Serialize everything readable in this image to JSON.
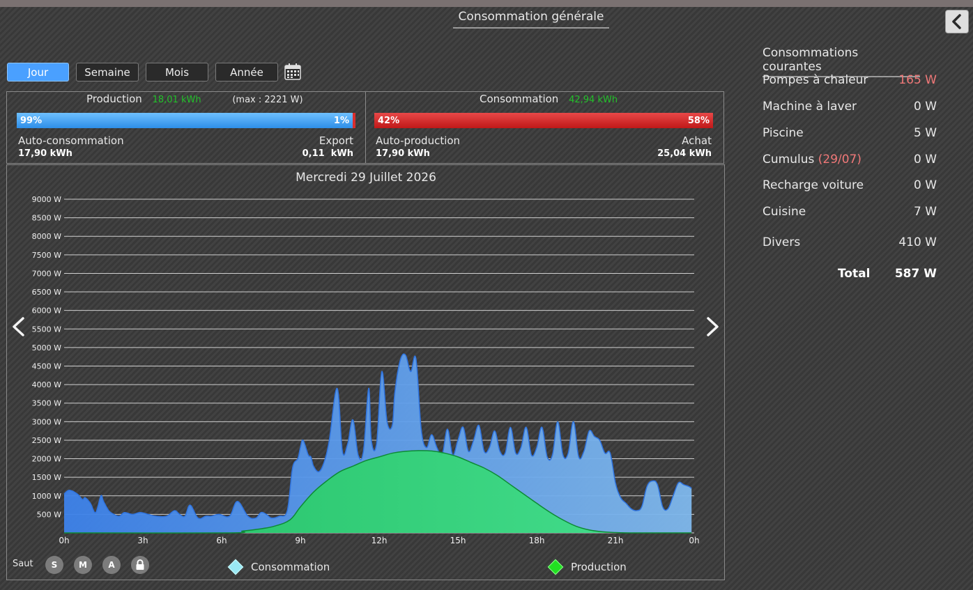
{
  "header": {
    "title": "Consommation générale"
  },
  "period_tabs": [
    {
      "label": "Jour",
      "active": true
    },
    {
      "label": "Semaine",
      "active": false
    },
    {
      "label": "Mois",
      "active": false
    },
    {
      "label": "Année",
      "active": false
    }
  ],
  "production": {
    "label": "Production",
    "total": "18,01 kWh",
    "max": "(max : 2221 W)",
    "bar_left": "99%",
    "bar_right": "1%",
    "self_label": "Auto-consommation",
    "self_value": "17,90 kWh",
    "export_label": "Export",
    "export_value": "0,11  kWh"
  },
  "consumption": {
    "label": "Consommation",
    "total": "42,94 kWh",
    "bar_left": "42%",
    "bar_right": "58%",
    "self_label": "Auto-production",
    "self_value": "17,90 kWh",
    "buy_label": "Achat",
    "buy_value": "25,04 kWh"
  },
  "colors": {
    "accent": "#4aa0ff",
    "production_value": "#22c02a",
    "consumption_fill": "#4a90e8",
    "production_fill": "#2ed36e",
    "alert": "#f07878"
  },
  "jump": {
    "label": "Saut",
    "buttons": [
      "S",
      "M",
      "A"
    ],
    "lock_icon": "lock-icon"
  },
  "chart_data": {
    "type": "area",
    "title": "Mercredi 29 Juillet 2026",
    "x_ticks": [
      "0h",
      "3h",
      "6h",
      "9h",
      "12h",
      "15h",
      "18h",
      "21h",
      "0h"
    ],
    "y_ticks": [
      "500 W",
      "1000 W",
      "1500 W",
      "2000 W",
      "2500 W",
      "3000 W",
      "3500 W",
      "4000 W",
      "4500 W",
      "5000 W",
      "5500 W",
      "6000 W",
      "6500 W",
      "7000 W",
      "7500 W",
      "8000 W",
      "8500 W",
      "9000 W"
    ],
    "ylim": [
      0,
      9000
    ],
    "xlim": [
      0,
      24
    ],
    "grid": true,
    "legend": "bottom",
    "series": [
      {
        "name": "Consommation",
        "x": [
          0,
          0.2,
          0.5,
          0.7,
          0.8,
          1.0,
          1.2,
          1.4,
          1.5,
          1.7,
          1.9,
          2.1,
          2.3,
          2.6,
          2.9,
          3.2,
          3.5,
          3.9,
          4.2,
          4.4,
          4.6,
          4.8,
          5.1,
          5.4,
          5.6,
          5.9,
          6.3,
          6.6,
          7.0,
          7.3,
          7.5,
          7.7,
          7.9,
          8.2,
          8.5,
          8.7,
          8.9,
          9.0,
          9.1,
          9.3,
          9.4,
          9.5,
          9.7,
          9.9,
          10.1,
          10.4,
          10.6,
          10.8,
          11.0,
          11.2,
          11.4,
          11.6,
          11.7,
          11.9,
          12.1,
          12.3,
          12.5,
          12.6,
          12.8,
          13.0,
          13.2,
          13.4,
          13.6,
          13.8,
          14.0,
          14.2,
          14.4,
          14.6,
          14.8,
          15.0,
          15.2,
          15.4,
          15.6,
          15.8,
          16.0,
          16.2,
          16.4,
          16.6,
          16.8,
          17.0,
          17.2,
          17.4,
          17.6,
          17.8,
          18.0,
          18.2,
          18.4,
          18.6,
          18.8,
          19.0,
          19.2,
          19.4,
          19.6,
          19.8,
          20.0,
          20.2,
          20.4,
          20.6,
          20.8,
          21.0,
          21.2,
          21.4,
          21.6,
          21.8,
          22.0,
          22.2,
          22.4,
          22.6,
          22.8,
          23.0,
          23.2,
          23.4,
          23.6,
          23.8,
          23.9
        ],
        "values": [
          1050,
          1150,
          1050,
          900,
          950,
          800,
          550,
          1000,
          850,
          600,
          500,
          450,
          550,
          500,
          550,
          500,
          450,
          450,
          600,
          500,
          450,
          750,
          400,
          450,
          450,
          500,
          450,
          850,
          450,
          400,
          550,
          500,
          400,
          450,
          600,
          1750,
          2000,
          2300,
          2500,
          2100,
          2050,
          1800,
          1650,
          1900,
          2500,
          3900,
          2200,
          2400,
          3050,
          2100,
          2200,
          3900,
          2500,
          2400,
          4350,
          3000,
          2900,
          3800,
          4650,
          4800,
          4350,
          4700,
          2800,
          2300,
          2650,
          2300,
          2100,
          2800,
          2100,
          2500,
          2850,
          2200,
          2500,
          2900,
          2200,
          2300,
          2750,
          2200,
          2150,
          2850,
          2150,
          2300,
          2850,
          2100,
          2300,
          2850,
          2050,
          2100,
          3000,
          2100,
          2150,
          3000,
          2050,
          2200,
          2750,
          2600,
          2500,
          2150,
          2150,
          1350,
          950,
          800,
          650,
          600,
          700,
          1250,
          1400,
          1300,
          700,
          650,
          1000,
          1350,
          1300,
          1250,
          1200
        ],
        "color": "#4a90e8"
      },
      {
        "name": "Production",
        "x": [
          0,
          6.2,
          6.8,
          7.4,
          8.0,
          8.6,
          9.0,
          9.5,
          10.0,
          10.5,
          11.0,
          11.5,
          12.0,
          12.5,
          13.0,
          13.5,
          14.0,
          14.5,
          15.0,
          15.5,
          16.0,
          16.5,
          17.0,
          17.5,
          18.0,
          18.5,
          19.0,
          19.5,
          20.0,
          20.5,
          21.0,
          21.5,
          22.0,
          23.9
        ],
        "values": [
          0,
          0,
          50,
          100,
          180,
          350,
          700,
          1100,
          1400,
          1650,
          1800,
          1950,
          2050,
          2150,
          2200,
          2220,
          2210,
          2150,
          2050,
          1900,
          1750,
          1550,
          1300,
          1050,
          800,
          560,
          350,
          180,
          80,
          30,
          10,
          0,
          0,
          0
        ],
        "color": "#2ed36e"
      }
    ]
  },
  "sidebar": {
    "title": "Consommations courantes",
    "items": [
      {
        "label": "Pompes à chaleur",
        "value": "165 W",
        "note": ""
      },
      {
        "label": "Machine à laver",
        "value": "0 W",
        "note": ""
      },
      {
        "label": "Piscine",
        "value": "5 W",
        "note": ""
      },
      {
        "label": "Cumulus ",
        "value": "0 W",
        "note": "(29/07)"
      },
      {
        "label": "Recharge voiture",
        "value": "0 W",
        "note": ""
      },
      {
        "label": "Cuisine",
        "value": "7 W",
        "note": ""
      },
      {
        "label": "Divers",
        "value": "410 W",
        "note": ""
      }
    ],
    "total_label": "Total",
    "total_value": "587 W"
  }
}
